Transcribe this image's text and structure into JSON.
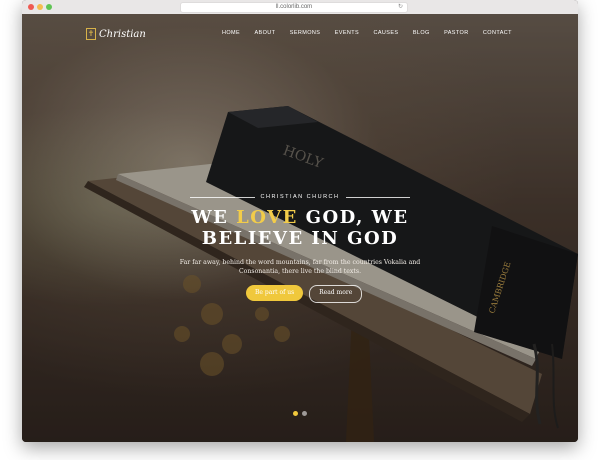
{
  "browser": {
    "url": "ll.colorlib.com"
  },
  "site": {
    "logo_text": "Christian",
    "logo_glyph": "✝"
  },
  "nav": {
    "items": [
      "HOME",
      "ABOUT",
      "SERMONS",
      "EVENTS",
      "CAUSES",
      "BLOG",
      "PASTOR",
      "CONTACT"
    ]
  },
  "hero": {
    "kicker": "CHRISTIAN CHURCH",
    "headline_part1": "WE ",
    "headline_highlight": "LOVE",
    "headline_part2": " GOD, WE",
    "headline_line2": "BELIEVE IN GOD",
    "subtext": "Far far away, behind the word mountains, far from the countries Vokalia and Consonantia, there live the blind texts.",
    "primary_button": "Be part of us",
    "secondary_button": "Read more",
    "slides": 2,
    "active_slide": 1,
    "highlight_color": "#f2cc4a"
  }
}
